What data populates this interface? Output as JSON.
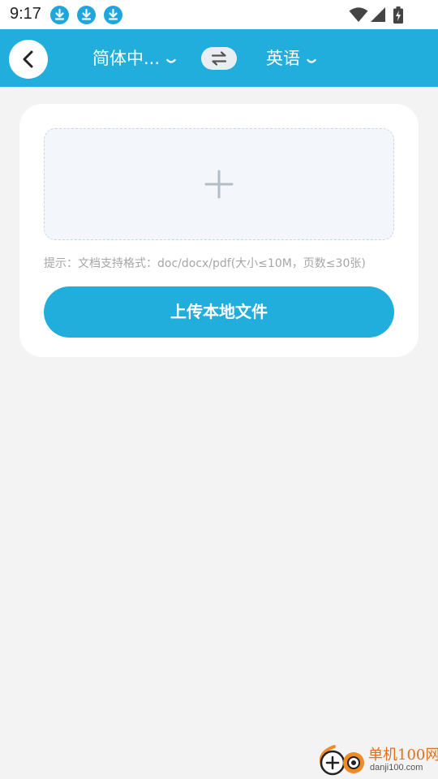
{
  "status_bar": {
    "time": "9:17",
    "notification_icons": [
      "download-icon",
      "download-icon",
      "download-icon"
    ],
    "system_icons": [
      "wifi-icon",
      "signal-icon",
      "battery-charging-icon"
    ]
  },
  "header": {
    "back_icon": "chevron-left-icon",
    "source_language": "简体中...",
    "swap_icon": "swap-arrows-icon",
    "target_language": "英语",
    "dropdown_icon": "chevron-down-icon"
  },
  "upload_card": {
    "add_icon": "plus-icon",
    "hint": "提示：文档支持格式：doc/docx/pdf(大小≤10M，页数≤30张)",
    "upload_button_label": "上传本地文件"
  },
  "watermark": {
    "title": "单机100网",
    "url": "danji100.com"
  },
  "colors": {
    "accent": "#21aedd",
    "background": "#f3f3f3",
    "card": "#ffffff",
    "hint_text": "#a6a6a6",
    "upload_area": "#f3f6fa"
  }
}
